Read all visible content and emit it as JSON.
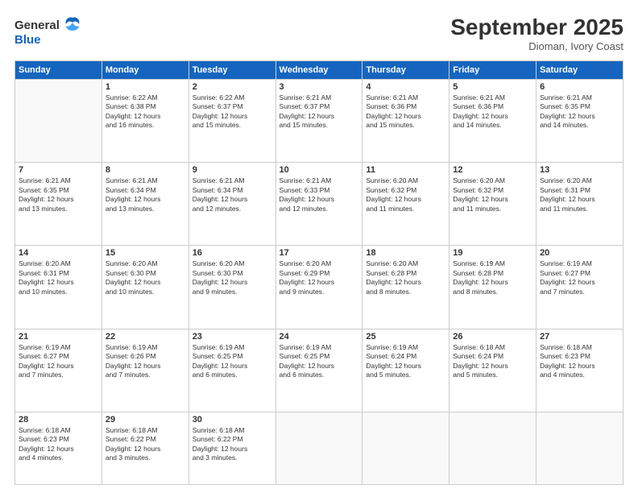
{
  "header": {
    "logo_general": "General",
    "logo_blue": "Blue",
    "month": "September 2025",
    "location": "Dioman, Ivory Coast"
  },
  "weekdays": [
    "Sunday",
    "Monday",
    "Tuesday",
    "Wednesday",
    "Thursday",
    "Friday",
    "Saturday"
  ],
  "weeks": [
    [
      {
        "day": "",
        "sunrise": "",
        "sunset": "",
        "daylight": ""
      },
      {
        "day": "1",
        "sunrise": "Sunrise: 6:22 AM",
        "sunset": "Sunset: 6:38 PM",
        "daylight": "Daylight: 12 hours and 16 minutes."
      },
      {
        "day": "2",
        "sunrise": "Sunrise: 6:22 AM",
        "sunset": "Sunset: 6:37 PM",
        "daylight": "Daylight: 12 hours and 15 minutes."
      },
      {
        "day": "3",
        "sunrise": "Sunrise: 6:21 AM",
        "sunset": "Sunset: 6:37 PM",
        "daylight": "Daylight: 12 hours and 15 minutes."
      },
      {
        "day": "4",
        "sunrise": "Sunrise: 6:21 AM",
        "sunset": "Sunset: 6:36 PM",
        "daylight": "Daylight: 12 hours and 15 minutes."
      },
      {
        "day": "5",
        "sunrise": "Sunrise: 6:21 AM",
        "sunset": "Sunset: 6:36 PM",
        "daylight": "Daylight: 12 hours and 14 minutes."
      },
      {
        "day": "6",
        "sunrise": "Sunrise: 6:21 AM",
        "sunset": "Sunset: 6:35 PM",
        "daylight": "Daylight: 12 hours and 14 minutes."
      }
    ],
    [
      {
        "day": "7",
        "sunrise": "Sunrise: 6:21 AM",
        "sunset": "Sunset: 6:35 PM",
        "daylight": "Daylight: 12 hours and 13 minutes."
      },
      {
        "day": "8",
        "sunrise": "Sunrise: 6:21 AM",
        "sunset": "Sunset: 6:34 PM",
        "daylight": "Daylight: 12 hours and 13 minutes."
      },
      {
        "day": "9",
        "sunrise": "Sunrise: 6:21 AM",
        "sunset": "Sunset: 6:34 PM",
        "daylight": "Daylight: 12 hours and 12 minutes."
      },
      {
        "day": "10",
        "sunrise": "Sunrise: 6:21 AM",
        "sunset": "Sunset: 6:33 PM",
        "daylight": "Daylight: 12 hours and 12 minutes."
      },
      {
        "day": "11",
        "sunrise": "Sunrise: 6:20 AM",
        "sunset": "Sunset: 6:32 PM",
        "daylight": "Daylight: 12 hours and 11 minutes."
      },
      {
        "day": "12",
        "sunrise": "Sunrise: 6:20 AM",
        "sunset": "Sunset: 6:32 PM",
        "daylight": "Daylight: 12 hours and 11 minutes."
      },
      {
        "day": "13",
        "sunrise": "Sunrise: 6:20 AM",
        "sunset": "Sunset: 6:31 PM",
        "daylight": "Daylight: 12 hours and 11 minutes."
      }
    ],
    [
      {
        "day": "14",
        "sunrise": "Sunrise: 6:20 AM",
        "sunset": "Sunset: 6:31 PM",
        "daylight": "Daylight: 12 hours and 10 minutes."
      },
      {
        "day": "15",
        "sunrise": "Sunrise: 6:20 AM",
        "sunset": "Sunset: 6:30 PM",
        "daylight": "Daylight: 12 hours and 10 minutes."
      },
      {
        "day": "16",
        "sunrise": "Sunrise: 6:20 AM",
        "sunset": "Sunset: 6:30 PM",
        "daylight": "Daylight: 12 hours and 9 minutes."
      },
      {
        "day": "17",
        "sunrise": "Sunrise: 6:20 AM",
        "sunset": "Sunset: 6:29 PM",
        "daylight": "Daylight: 12 hours and 9 minutes."
      },
      {
        "day": "18",
        "sunrise": "Sunrise: 6:20 AM",
        "sunset": "Sunset: 6:28 PM",
        "daylight": "Daylight: 12 hours and 8 minutes."
      },
      {
        "day": "19",
        "sunrise": "Sunrise: 6:19 AM",
        "sunset": "Sunset: 6:28 PM",
        "daylight": "Daylight: 12 hours and 8 minutes."
      },
      {
        "day": "20",
        "sunrise": "Sunrise: 6:19 AM",
        "sunset": "Sunset: 6:27 PM",
        "daylight": "Daylight: 12 hours and 7 minutes."
      }
    ],
    [
      {
        "day": "21",
        "sunrise": "Sunrise: 6:19 AM",
        "sunset": "Sunset: 6:27 PM",
        "daylight": "Daylight: 12 hours and 7 minutes."
      },
      {
        "day": "22",
        "sunrise": "Sunrise: 6:19 AM",
        "sunset": "Sunset: 6:26 PM",
        "daylight": "Daylight: 12 hours and 7 minutes."
      },
      {
        "day": "23",
        "sunrise": "Sunrise: 6:19 AM",
        "sunset": "Sunset: 6:25 PM",
        "daylight": "Daylight: 12 hours and 6 minutes."
      },
      {
        "day": "24",
        "sunrise": "Sunrise: 6:19 AM",
        "sunset": "Sunset: 6:25 PM",
        "daylight": "Daylight: 12 hours and 6 minutes."
      },
      {
        "day": "25",
        "sunrise": "Sunrise: 6:19 AM",
        "sunset": "Sunset: 6:24 PM",
        "daylight": "Daylight: 12 hours and 5 minutes."
      },
      {
        "day": "26",
        "sunrise": "Sunrise: 6:18 AM",
        "sunset": "Sunset: 6:24 PM",
        "daylight": "Daylight: 12 hours and 5 minutes."
      },
      {
        "day": "27",
        "sunrise": "Sunrise: 6:18 AM",
        "sunset": "Sunset: 6:23 PM",
        "daylight": "Daylight: 12 hours and 4 minutes."
      }
    ],
    [
      {
        "day": "28",
        "sunrise": "Sunrise: 6:18 AM",
        "sunset": "Sunset: 6:23 PM",
        "daylight": "Daylight: 12 hours and 4 minutes."
      },
      {
        "day": "29",
        "sunrise": "Sunrise: 6:18 AM",
        "sunset": "Sunset: 6:22 PM",
        "daylight": "Daylight: 12 hours and 3 minutes."
      },
      {
        "day": "30",
        "sunrise": "Sunrise: 6:18 AM",
        "sunset": "Sunset: 6:22 PM",
        "daylight": "Daylight: 12 hours and 3 minutes."
      },
      {
        "day": "",
        "sunrise": "",
        "sunset": "",
        "daylight": ""
      },
      {
        "day": "",
        "sunrise": "",
        "sunset": "",
        "daylight": ""
      },
      {
        "day": "",
        "sunrise": "",
        "sunset": "",
        "daylight": ""
      },
      {
        "day": "",
        "sunrise": "",
        "sunset": "",
        "daylight": ""
      }
    ]
  ]
}
